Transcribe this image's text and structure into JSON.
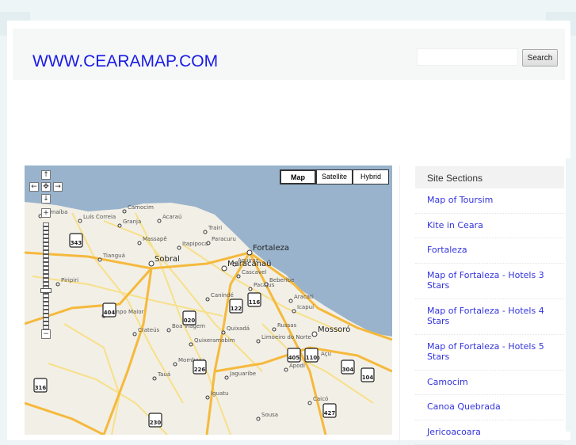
{
  "header": {
    "logo": "WWW.CEARAMAP.COM",
    "search_button": "Search",
    "search_value": ""
  },
  "map": {
    "types": [
      "Map",
      "Satellite",
      "Hybrid"
    ],
    "selected_type": "Map",
    "colors": {
      "sea": "#99b3cc",
      "land": "#f2efe6",
      "road": "#f5b93c",
      "minor": "#f7e08a"
    },
    "cities": [
      "Fortaleza",
      "Sobral",
      "Maracanaú",
      "Mossoró",
      "Camocim",
      "Itapipoca",
      "Canindé",
      "Quixadá",
      "Crateús",
      "Tauá",
      "Iguatu",
      "Aracati",
      "Granja",
      "Acaraú",
      "Trairi",
      "Pacajus",
      "Russas",
      "Jaguaribe",
      "Quixeramobim",
      "Boa Viagem",
      "Mombaça",
      "Limoeiro do Norte",
      "Apodi",
      "Açu",
      "Caicó",
      "Sousa",
      "Piripiri",
      "Campo Maior",
      "Parnaíba",
      "Luís Correia",
      "Tianguá",
      "Massapê",
      "Cascavel",
      "Beberibe",
      "Aquiraz",
      "Paracuru",
      "Icapuí"
    ],
    "highways": [
      "343",
      "404",
      "020",
      "122",
      "116",
      "405",
      "110",
      "226",
      "304",
      "104",
      "316",
      "230",
      "427"
    ]
  },
  "sidebar": {
    "title": "Site Sections",
    "items": [
      "Map of Toursim",
      "Kite in Ceara",
      "Fortaleza",
      "Map of Fortaleza - Hotels 3 Stars",
      "Map of Fortaleza - Hotels 4 Stars",
      "Map of Fortaleza - Hotels 5 Stars",
      "Camocim",
      "Canoa Quebrada",
      "Jericoacoara"
    ]
  }
}
